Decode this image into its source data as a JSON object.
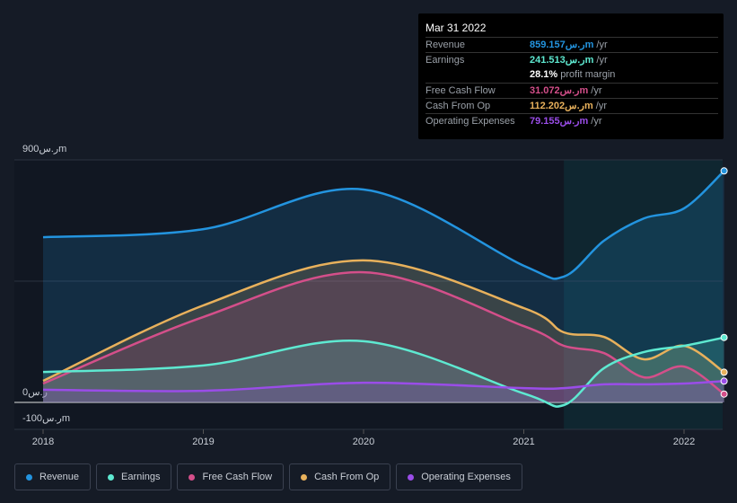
{
  "tooltip": {
    "date": "Mar 31 2022",
    "rows": [
      {
        "label": "Revenue",
        "value": "859.157ر.سm",
        "unit": " /yr",
        "color": "#2394df"
      },
      {
        "label": "Earnings",
        "value": "241.513ر.سm",
        "unit": " /yr",
        "color": "#5ee9d1"
      },
      {
        "label": "",
        "value": "28.1%",
        "unit": " profit margin",
        "color": "#ffffff"
      },
      {
        "label": "Free Cash Flow",
        "value": "31.072ر.سm",
        "unit": " /yr",
        "color": "#d44f8a"
      },
      {
        "label": "Cash From Op",
        "value": "112.202ر.سm",
        "unit": " /yr",
        "color": "#e8b15c"
      },
      {
        "label": "Operating Expenses",
        "value": "79.155ر.سm",
        "unit": " /yr",
        "color": "#9a4de8"
      }
    ]
  },
  "chart_data": {
    "type": "area",
    "ylim": [
      -100,
      900
    ],
    "xlim": [
      2017.9,
      2022.25
    ],
    "y_ticks": [
      {
        "v": 900,
        "label": "900ر.سm"
      },
      {
        "v": 0,
        "label": "0ر.س"
      },
      {
        "v": -100,
        "label": "-100ر.سm"
      }
    ],
    "x_ticks": [
      {
        "v": 2018,
        "label": "2018"
      },
      {
        "v": 2019,
        "label": "2019"
      },
      {
        "v": 2020,
        "label": "2020"
      },
      {
        "v": 2021,
        "label": "2021"
      },
      {
        "v": 2022,
        "label": "2022"
      }
    ],
    "highlight_from": 2021.25,
    "x": [
      2018,
      2019,
      2020,
      2021,
      2021.25,
      2021.5,
      2021.75,
      2022,
      2022.25
    ],
    "series": [
      {
        "name": "Revenue",
        "color": "#2394df",
        "values": [
          613,
          643,
          790,
          507,
          467,
          600,
          683,
          720,
          859
        ]
      },
      {
        "name": "Cash From Op",
        "color": "#e8b15c",
        "values": [
          80,
          360,
          527,
          350,
          260,
          243,
          160,
          210,
          112
        ]
      },
      {
        "name": "Free Cash Flow",
        "color": "#d44f8a",
        "values": [
          70,
          317,
          483,
          283,
          210,
          183,
          93,
          133,
          31
        ]
      },
      {
        "name": "Earnings",
        "color": "#5ee9d1",
        "values": [
          113,
          137,
          227,
          33,
          -10,
          127,
          187,
          210,
          241
        ]
      },
      {
        "name": "Operating Expenses",
        "color": "#9a4de8",
        "values": [
          47,
          43,
          73,
          53,
          53,
          67,
          67,
          70,
          79
        ]
      }
    ]
  },
  "legend": [
    {
      "label": "Revenue",
      "color": "#2394df"
    },
    {
      "label": "Earnings",
      "color": "#5ee9d1"
    },
    {
      "label": "Free Cash Flow",
      "color": "#d44f8a"
    },
    {
      "label": "Cash From Op",
      "color": "#e8b15c"
    },
    {
      "label": "Operating Expenses",
      "color": "#9a4de8"
    }
  ]
}
